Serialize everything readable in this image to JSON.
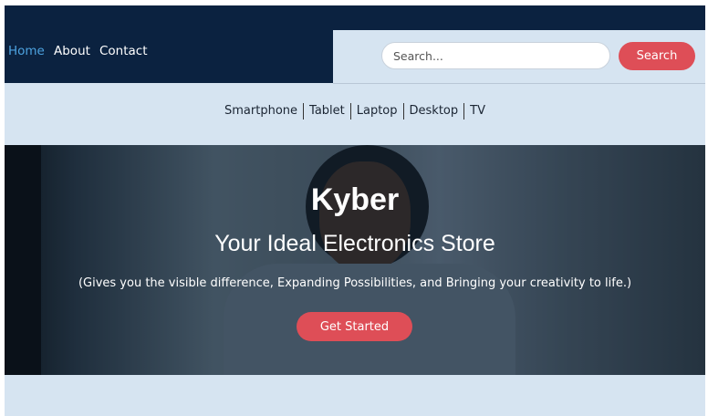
{
  "nav": {
    "links": [
      {
        "label": "Home",
        "active": true
      },
      {
        "label": "About",
        "active": false
      },
      {
        "label": "Contact",
        "active": false
      }
    ]
  },
  "search": {
    "placeholder": "Search...",
    "button_label": "Search"
  },
  "categories": [
    "Smartphone",
    "Tablet",
    "Laptop",
    "Desktop",
    "TV"
  ],
  "hero": {
    "title": "Kyber",
    "subtitle": "Your Ideal Electronics Store",
    "tagline": "(Gives you the visible difference, Expanding Possibilities, and Bringing your creativity to life.)",
    "cta_label": "Get Started"
  },
  "colors": {
    "navbar": "#0b2240",
    "page_background": "#d6e4f1",
    "accent": "#de4e57",
    "active_link": "#4da3e0"
  }
}
